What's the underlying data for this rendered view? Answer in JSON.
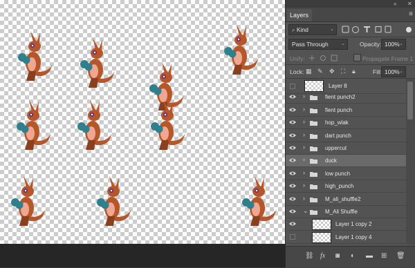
{
  "panel": {
    "title": "Layers",
    "filter_kind": "Kind",
    "blend_mode": "Pass Through",
    "opacity_label": "Opacity:",
    "opacity_value": "100%",
    "unify_label": "Unify:",
    "propagate_label": "Propagate Frame 1",
    "lock_label": "Lock:",
    "fill_label": "Fill:",
    "fill_value": "100%"
  },
  "layers": [
    {
      "name": "Layer 8",
      "type": "layer",
      "visible": false
    },
    {
      "name": "fient punch2",
      "type": "group",
      "visible": true
    },
    {
      "name": "fient punch",
      "type": "group",
      "visible": true
    },
    {
      "name": "hop_wlak",
      "type": "group",
      "visible": true
    },
    {
      "name": "dart punch",
      "type": "group",
      "visible": true
    },
    {
      "name": "uppercut",
      "type": "group",
      "visible": true
    },
    {
      "name": "duck",
      "type": "group",
      "visible": true,
      "selected": true
    },
    {
      "name": "low punch",
      "type": "group",
      "visible": true
    },
    {
      "name": "high_punch",
      "type": "group",
      "visible": true
    },
    {
      "name": "M_ali_shuffle2",
      "type": "group",
      "visible": true
    },
    {
      "name": "M_Ali Shuffle",
      "type": "group",
      "visible": true,
      "expanded": true
    },
    {
      "name": "Layer 1 copy 2",
      "type": "layer",
      "visible": true
    },
    {
      "name": "Layer 1 copy 4",
      "type": "layer",
      "visible": false
    }
  ],
  "colors": {
    "kangaroo_body": "#b5562b",
    "kangaroo_belly": "#f0a792",
    "glove": "#2f7f8c",
    "panel_bg": "#535353",
    "selected_row": "#6a6a6a"
  },
  "bottom_icons": [
    "link-icon",
    "fx-icon",
    "mask-icon",
    "adjustment-icon",
    "folder-icon",
    "new-layer-icon",
    "trash-icon"
  ]
}
